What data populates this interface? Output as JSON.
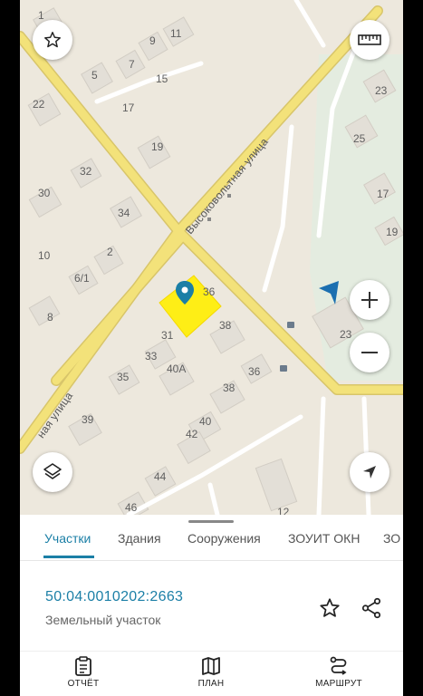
{
  "map": {
    "streets": {
      "vysokovoltnaya": "Высоковольтная улица",
      "lower": "ная улица"
    },
    "house_numbers": [
      {
        "id": "n1",
        "text": "1"
      },
      {
        "id": "n11",
        "text": "11"
      },
      {
        "id": "n9",
        "text": "9"
      },
      {
        "id": "n7",
        "text": "7"
      },
      {
        "id": "n5",
        "text": "5"
      },
      {
        "id": "n15",
        "text": "15"
      },
      {
        "id": "n22",
        "text": "22"
      },
      {
        "id": "n17a",
        "text": "17"
      },
      {
        "id": "n19",
        "text": "19"
      },
      {
        "id": "n32",
        "text": "32"
      },
      {
        "id": "n30",
        "text": "30"
      },
      {
        "id": "n34",
        "text": "34"
      },
      {
        "id": "n10",
        "text": "10"
      },
      {
        "id": "n2",
        "text": "2"
      },
      {
        "id": "n61",
        "text": "6/1"
      },
      {
        "id": "n8",
        "text": "8"
      },
      {
        "id": "n36a",
        "text": "36"
      },
      {
        "id": "n38a",
        "text": "38"
      },
      {
        "id": "n31",
        "text": "31"
      },
      {
        "id": "n33",
        "text": "33"
      },
      {
        "id": "n35",
        "text": "35"
      },
      {
        "id": "n40a",
        "text": "40А"
      },
      {
        "id": "n36b",
        "text": "36"
      },
      {
        "id": "n38b",
        "text": "38"
      },
      {
        "id": "n39",
        "text": "39"
      },
      {
        "id": "n40",
        "text": "40"
      },
      {
        "id": "n42",
        "text": "42"
      },
      {
        "id": "n44",
        "text": "44"
      },
      {
        "id": "n46",
        "text": "46"
      },
      {
        "id": "n23a",
        "text": "23"
      },
      {
        "id": "n25",
        "text": "25"
      },
      {
        "id": "n17b",
        "text": "17"
      },
      {
        "id": "n19b",
        "text": "19"
      },
      {
        "id": "n23b",
        "text": "23"
      },
      {
        "id": "n12",
        "text": "12"
      }
    ]
  },
  "tabs": [
    "Участки",
    "Здания",
    "Сооружения",
    "ЗОУИТ ОКН",
    "ЗО"
  ],
  "active_tab": "Участки",
  "parcel": {
    "cadastral_number": "50:04:0010202:2663",
    "type": "Земельный участок"
  },
  "bottom_nav": {
    "report": "ОТЧЁТ",
    "plan": "ПЛАН",
    "route": "МАРШРУТ"
  },
  "colors": {
    "accent": "#1b7fa6",
    "road": "#f3e27a",
    "selection": "#ffee00",
    "map_bg": "#ede8dd"
  },
  "icons": {
    "favorite": "star-icon",
    "ruler": "ruler-icon",
    "zoom_in": "plus-icon",
    "zoom_out": "minus-icon",
    "layers": "layers-icon",
    "locate": "navigation-arrow-icon",
    "share": "share-icon"
  }
}
